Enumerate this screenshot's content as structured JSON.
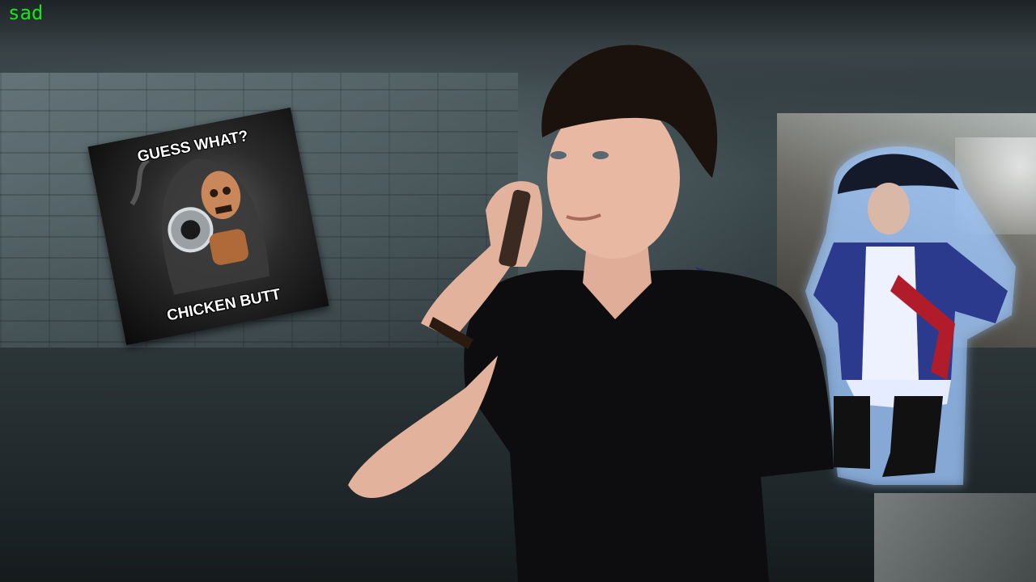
{
  "overlay": {
    "label": "sad"
  },
  "meme": {
    "top_text": "GUESS WHAT?",
    "bottom_text": "CHICKEN BUTT"
  }
}
